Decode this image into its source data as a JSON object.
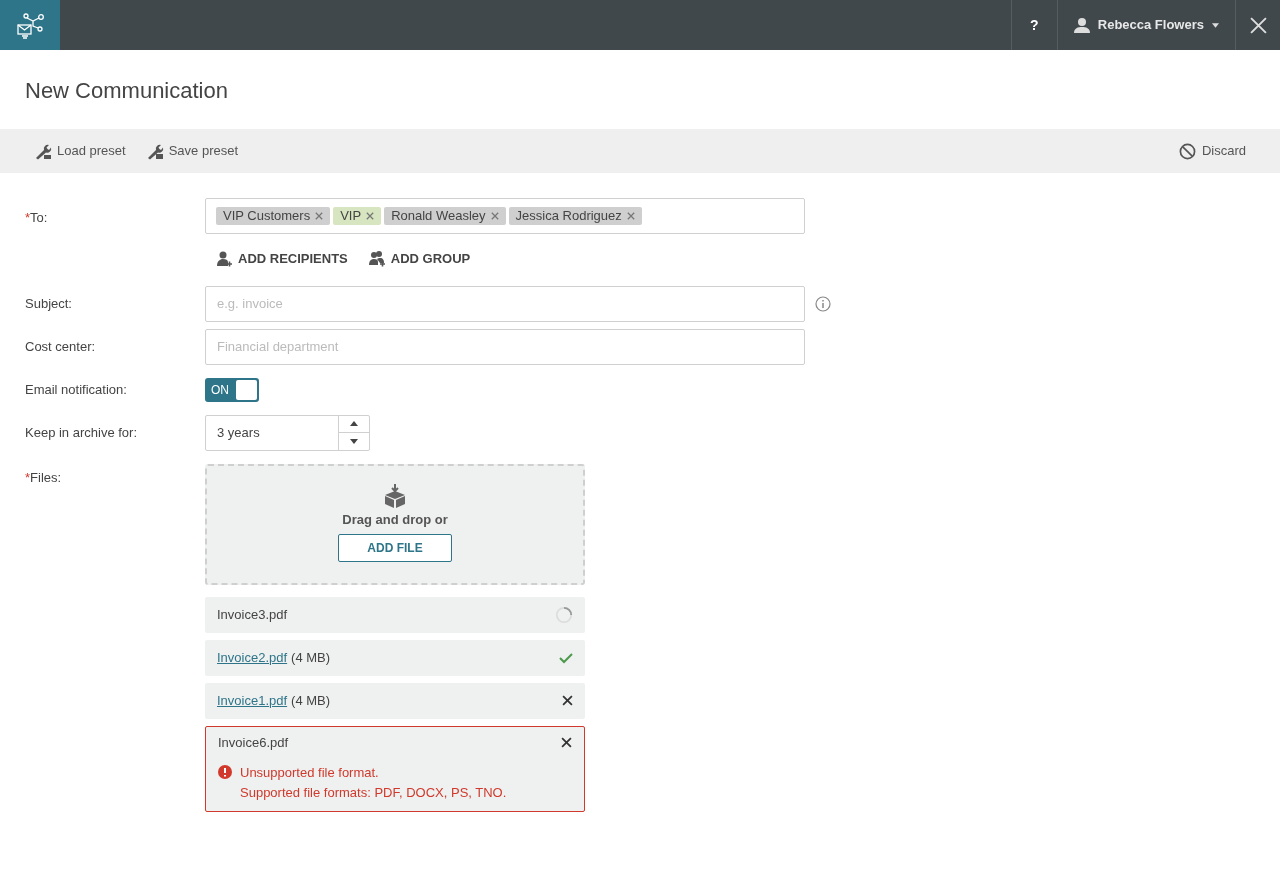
{
  "topbar": {
    "help": "?",
    "user": "Rebecca Flowers"
  },
  "page": {
    "title": "New Communication"
  },
  "toolbar": {
    "actions": [
      "Load preset",
      "Save preset"
    ],
    "discard": "Discard"
  },
  "form": {
    "to": {
      "required_mark": "*",
      "label": "To:",
      "tags": [
        {
          "label": "VIP Customers",
          "color": "#cfcfcf"
        },
        {
          "label": "VIP",
          "color": "#d7e6c0"
        },
        {
          "label": "Ronald Weasley",
          "color": "#cfcfcf"
        },
        {
          "label": "Jessica Rodriguez",
          "color": "#cfcfcf"
        }
      ],
      "buttons": [
        "ADD RECIPIENTS",
        "ADD GROUP"
      ]
    },
    "subject": {
      "label": "Subject:",
      "placeholder": "e.g. invoice"
    },
    "cost_center": {
      "label": "Cost center:",
      "placeholder": "Financial department"
    },
    "email_notification": {
      "label": "Email notification:",
      "on": true,
      "toggle_text": "ON"
    },
    "archive": {
      "label": "Keep in archive for:",
      "value": "3 years"
    },
    "files": {
      "required_mark": "*",
      "label": "Files:",
      "drop_text": "Drag and drop or",
      "add_button": "ADD FILE",
      "items": [
        {
          "kind": "uploading",
          "name": "Invoice3.pdf"
        },
        {
          "kind": "done",
          "name": "Invoice2.pdf",
          "size": "(4 MB)"
        },
        {
          "kind": "uploaded",
          "name": "Invoice1.pdf",
          "size": "(4 MB)"
        },
        {
          "kind": "error",
          "name": "Invoice6.pdf",
          "error": [
            "Unsupported file format.",
            "Supported file formats: PDF, DOCX, PS, TNO."
          ]
        }
      ]
    }
  }
}
